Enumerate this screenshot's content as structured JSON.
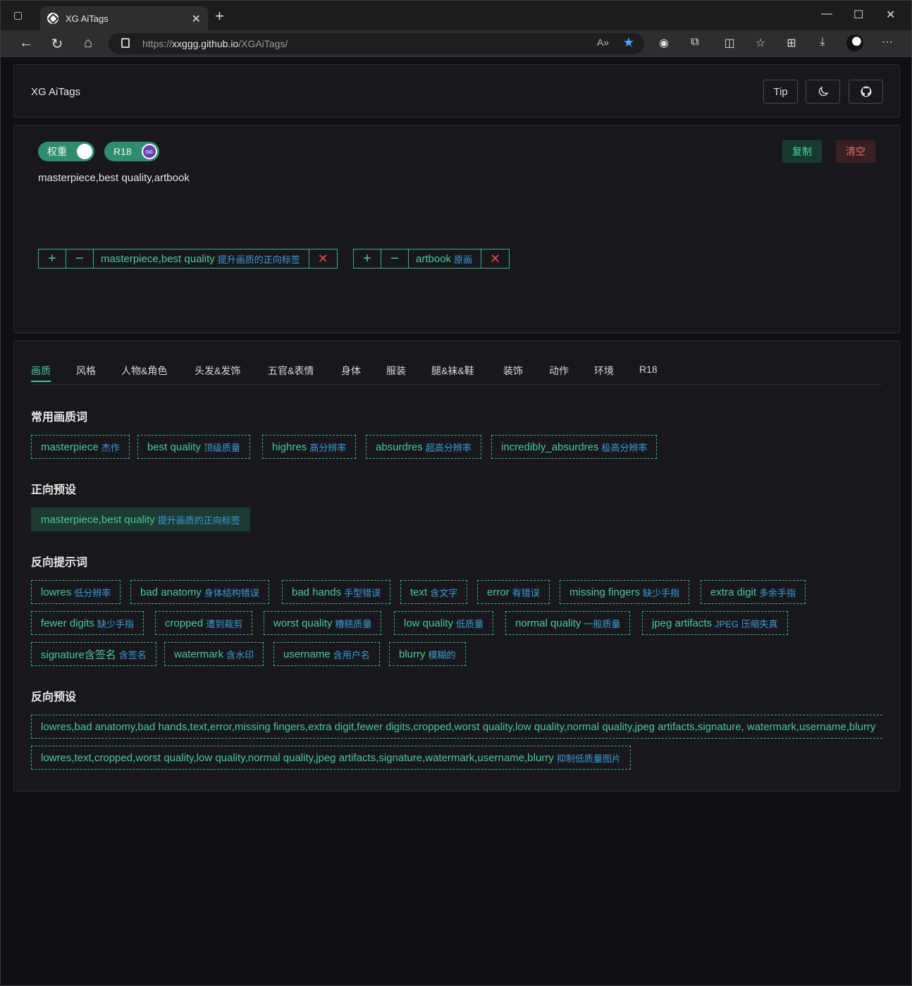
{
  "browser": {
    "tab_title": "XG AiTags",
    "url_prefix": "https://",
    "url_host": "xxggg.github.io",
    "url_path": "/XGAiTags/"
  },
  "header": {
    "brand": "XG AiTags",
    "tip_label": "Tip"
  },
  "editor": {
    "weight_toggle": "权重",
    "r18_toggle": "R18",
    "copy_label": "复制",
    "clear_label": "清空",
    "prompt_text": "masterpiece,best quality,artbook",
    "chips": [
      {
        "en": "masterpiece,best quality",
        "zh": "提升画质的正向标签"
      },
      {
        "en": "artbook",
        "zh": "原画"
      }
    ]
  },
  "library": {
    "tabs": [
      "画质",
      "风格",
      "人物&角色",
      "头发&发饰",
      "五官&表情",
      "身体",
      "服装",
      "腿&袜&鞋",
      "装饰",
      "动作",
      "环境",
      "R18"
    ],
    "active_tab": "画质",
    "sections": [
      {
        "title": "常用画质词",
        "tags": [
          {
            "en": "masterpiece",
            "zh": "杰作"
          },
          {
            "en": "best quality",
            "zh": "顶级质量"
          },
          {
            "en": "highres",
            "zh": "高分辨率"
          },
          {
            "en": "absurdres",
            "zh": "超高分辨率"
          },
          {
            "en": "incredibly_absurdres",
            "zh": "极高分辨率"
          }
        ]
      },
      {
        "title": "正向预设",
        "tags": [
          {
            "en": "masterpiece,best quality",
            "zh": "提升画质的正向标签"
          }
        ]
      },
      {
        "title": "反向提示词",
        "tags": [
          {
            "en": "lowres",
            "zh": "低分辨率"
          },
          {
            "en": "bad anatomy",
            "zh": "身体结构错误"
          },
          {
            "en": "bad hands",
            "zh": "手型错误"
          },
          {
            "en": "text",
            "zh": "含文字"
          },
          {
            "en": "error",
            "zh": "有错误"
          },
          {
            "en": "missing fingers",
            "zh": "缺少手指"
          },
          {
            "en": "extra digit",
            "zh": "多余手指"
          },
          {
            "en": "fewer digits",
            "zh": "缺少手指"
          },
          {
            "en": "cropped",
            "zh": "遭到裁剪"
          },
          {
            "en": "worst quality",
            "zh": "糟糕质量"
          },
          {
            "en": "low quality",
            "zh": "低质量"
          },
          {
            "en": "normal quality",
            "zh": "一般质量"
          },
          {
            "en": "jpeg artifacts",
            "zh": "JPEG 压缩失真"
          },
          {
            "en": "signature含签名",
            "zh": "含签名"
          },
          {
            "en": "watermark",
            "zh": "含水印"
          },
          {
            "en": "username",
            "zh": "含用户名"
          },
          {
            "en": "blurry",
            "zh": "模糊的"
          }
        ]
      },
      {
        "title": "反向预设",
        "tags": [
          {
            "en": "lowres,bad anatomy,bad hands,text,error,missing fingers,extra digit,fewer digits,cropped,worst quality,low quality,normal quality,jpeg artifacts,signature, watermark,username,blurry",
            "zh": ""
          },
          {
            "en": "lowres,text,cropped,worst quality,low quality,normal quality,jpeg artifacts,signature,watermark,username,blurry",
            "zh": "抑制低质量图片"
          }
        ]
      }
    ]
  },
  "colors": {
    "accent": "#40c696",
    "tag_zh": "#3b9bd6",
    "danger": "#e5484d"
  }
}
